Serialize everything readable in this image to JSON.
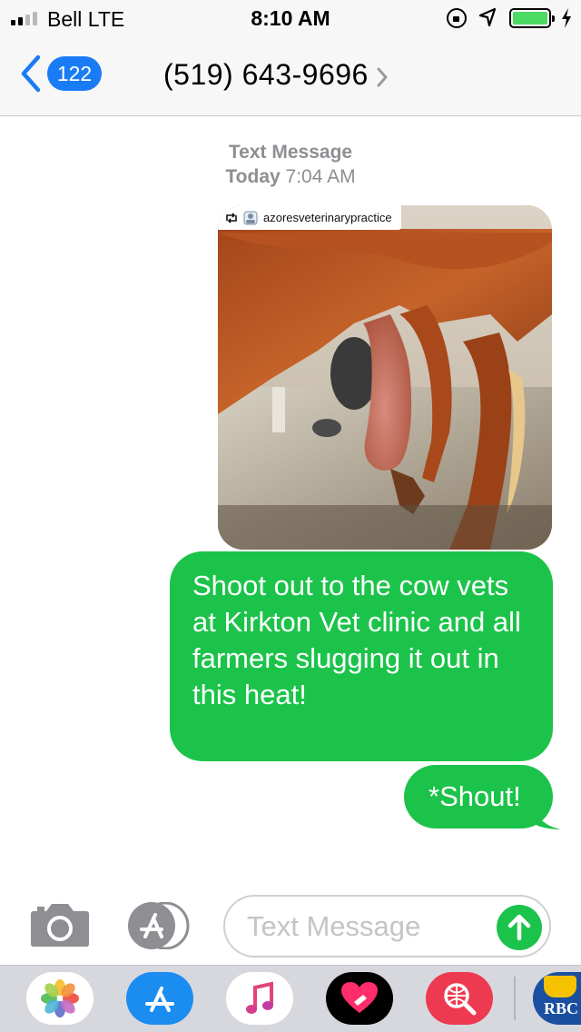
{
  "status_bar": {
    "carrier": "Bell  LTE",
    "time": "8:10 AM",
    "signal_bars_filled": 2,
    "signal_bars_total": 4,
    "battery_level": 1.0,
    "icons": [
      "signal-icon",
      "orientation-lock-icon",
      "location-icon",
      "battery-icon",
      "charging-bolt-icon"
    ]
  },
  "header": {
    "back_count": "122",
    "contact": "(519) 643-9696",
    "icons": [
      "back-chevron-icon",
      "contact-details-chevron-icon"
    ]
  },
  "conversation": {
    "service_label": "Text Message",
    "day": "Today",
    "time": "7:04 AM",
    "attachment": {
      "attribution": "azoresveterinarypractice",
      "icons": [
        "repost-icon",
        "profile-icon"
      ]
    },
    "messages": [
      "Shoot out to the cow vets at Kirkton Vet clinic and all farmers slugging it out in this heat!",
      "*Shout!"
    ],
    "bubble_color": "#1cc34a"
  },
  "input_bar": {
    "placeholder": "Text Message",
    "value": "",
    "icons": [
      "camera-icon",
      "app-store-icon",
      "send-arrow-icon"
    ]
  },
  "app_drawer": {
    "apps": [
      "photos-app-icon",
      "app-store-app-icon",
      "music-app-icon",
      "digital-touch-app-icon",
      "web-images-search-app-icon",
      "rbc-app-icon"
    ],
    "rbc_label": "RBC"
  }
}
